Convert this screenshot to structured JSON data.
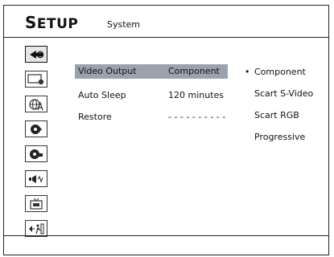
{
  "header": {
    "title_first": "S",
    "title_rest": "ETUP",
    "subtitle": "System"
  },
  "sidebar": {
    "items": [
      {
        "icon": "system-icon",
        "active": true
      },
      {
        "icon": "display-icon",
        "active": false
      },
      {
        "icon": "language-icon",
        "active": false
      },
      {
        "icon": "audio-icon",
        "active": false
      },
      {
        "icon": "video-icon",
        "active": false
      },
      {
        "icon": "speaker-icon",
        "active": false
      },
      {
        "icon": "tv-icon",
        "active": false
      },
      {
        "icon": "exit-icon",
        "active": false
      }
    ]
  },
  "settings": [
    {
      "label": "Video Output",
      "value": "Component"
    },
    {
      "label": "Auto Sleep",
      "value": "120 minutes"
    },
    {
      "label": "Restore",
      "value": "- - - - - - - - - -"
    }
  ],
  "options": {
    "bullet": "•",
    "items": [
      "Component",
      "Scart S-Video",
      "Scart RGB",
      "Progressive"
    ]
  }
}
